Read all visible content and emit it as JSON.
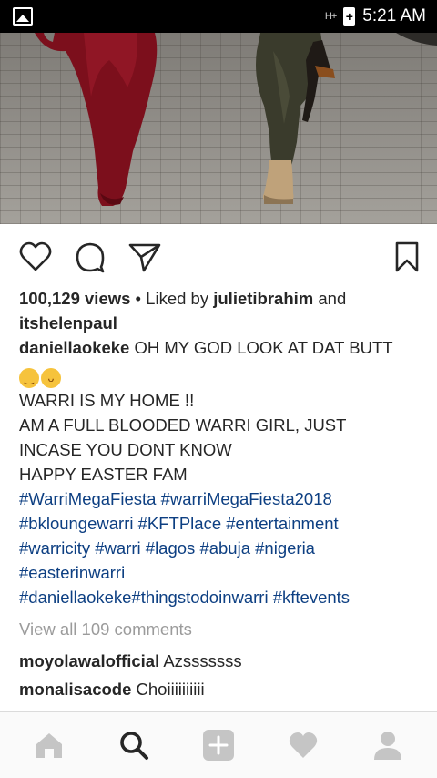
{
  "status_bar": {
    "time": "5:21 AM",
    "signal_label": "H+",
    "icons": [
      "gallery-icon",
      "signal-icon",
      "battery-charging-icon"
    ]
  },
  "post": {
    "photo_alt": "",
    "actions": {
      "icons": [
        "heart-icon",
        "comment-icon",
        "share-icon",
        "bookmark-icon"
      ]
    },
    "likes": {
      "views": "100,129 views",
      "liked_by_prefix": " • Liked by ",
      "liked_by_user": "julietibrahim",
      "and_text": " and",
      "second_user": "itshelenpaul"
    },
    "caption": {
      "username": "daniellaokeke",
      "line1": " OH MY GOD LOOK AT DAT BUTT",
      "emojis": [
        "😂",
        "😝"
      ],
      "line2": "WARRI IS MY HOME !!",
      "line3": "AM A FULL BLOODED WARRI GIRL, JUST",
      "line4": "INCASE YOU DONT KNOW",
      "line5": "HAPPY EASTER FAM",
      "hashtags": [
        [
          "#WarriMegaFiesta",
          "#warriMegaFiesta2018"
        ],
        [
          "#bkloungewarri",
          "#KFTPlace",
          "#entertainment"
        ],
        [
          "#warricity",
          "#warri",
          "#lagos",
          "#abuja",
          "#nigeria"
        ],
        [
          "#easterinwarri"
        ],
        [
          "#daniellaokeke#thingstodoinwarri",
          "#kftevents"
        ]
      ]
    },
    "view_all_comments": "View all 109 comments",
    "comments": [
      {
        "username": "moyolawalofficial",
        "text": " Azsssssss"
      },
      {
        "username": "monalisacode",
        "text": " Choiiiiiiiiii"
      }
    ]
  },
  "bottom_nav": {
    "items": [
      "home-icon",
      "search-icon",
      "add-post-icon",
      "activity-heart-icon",
      "profile-icon"
    ],
    "active": "search-icon"
  },
  "colors": {
    "hashtag": "#0d3f82",
    "text": "#262626",
    "muted": "#9b9b9b",
    "nav_inactive": "#c5c5c5",
    "nav_active": "#262626"
  }
}
